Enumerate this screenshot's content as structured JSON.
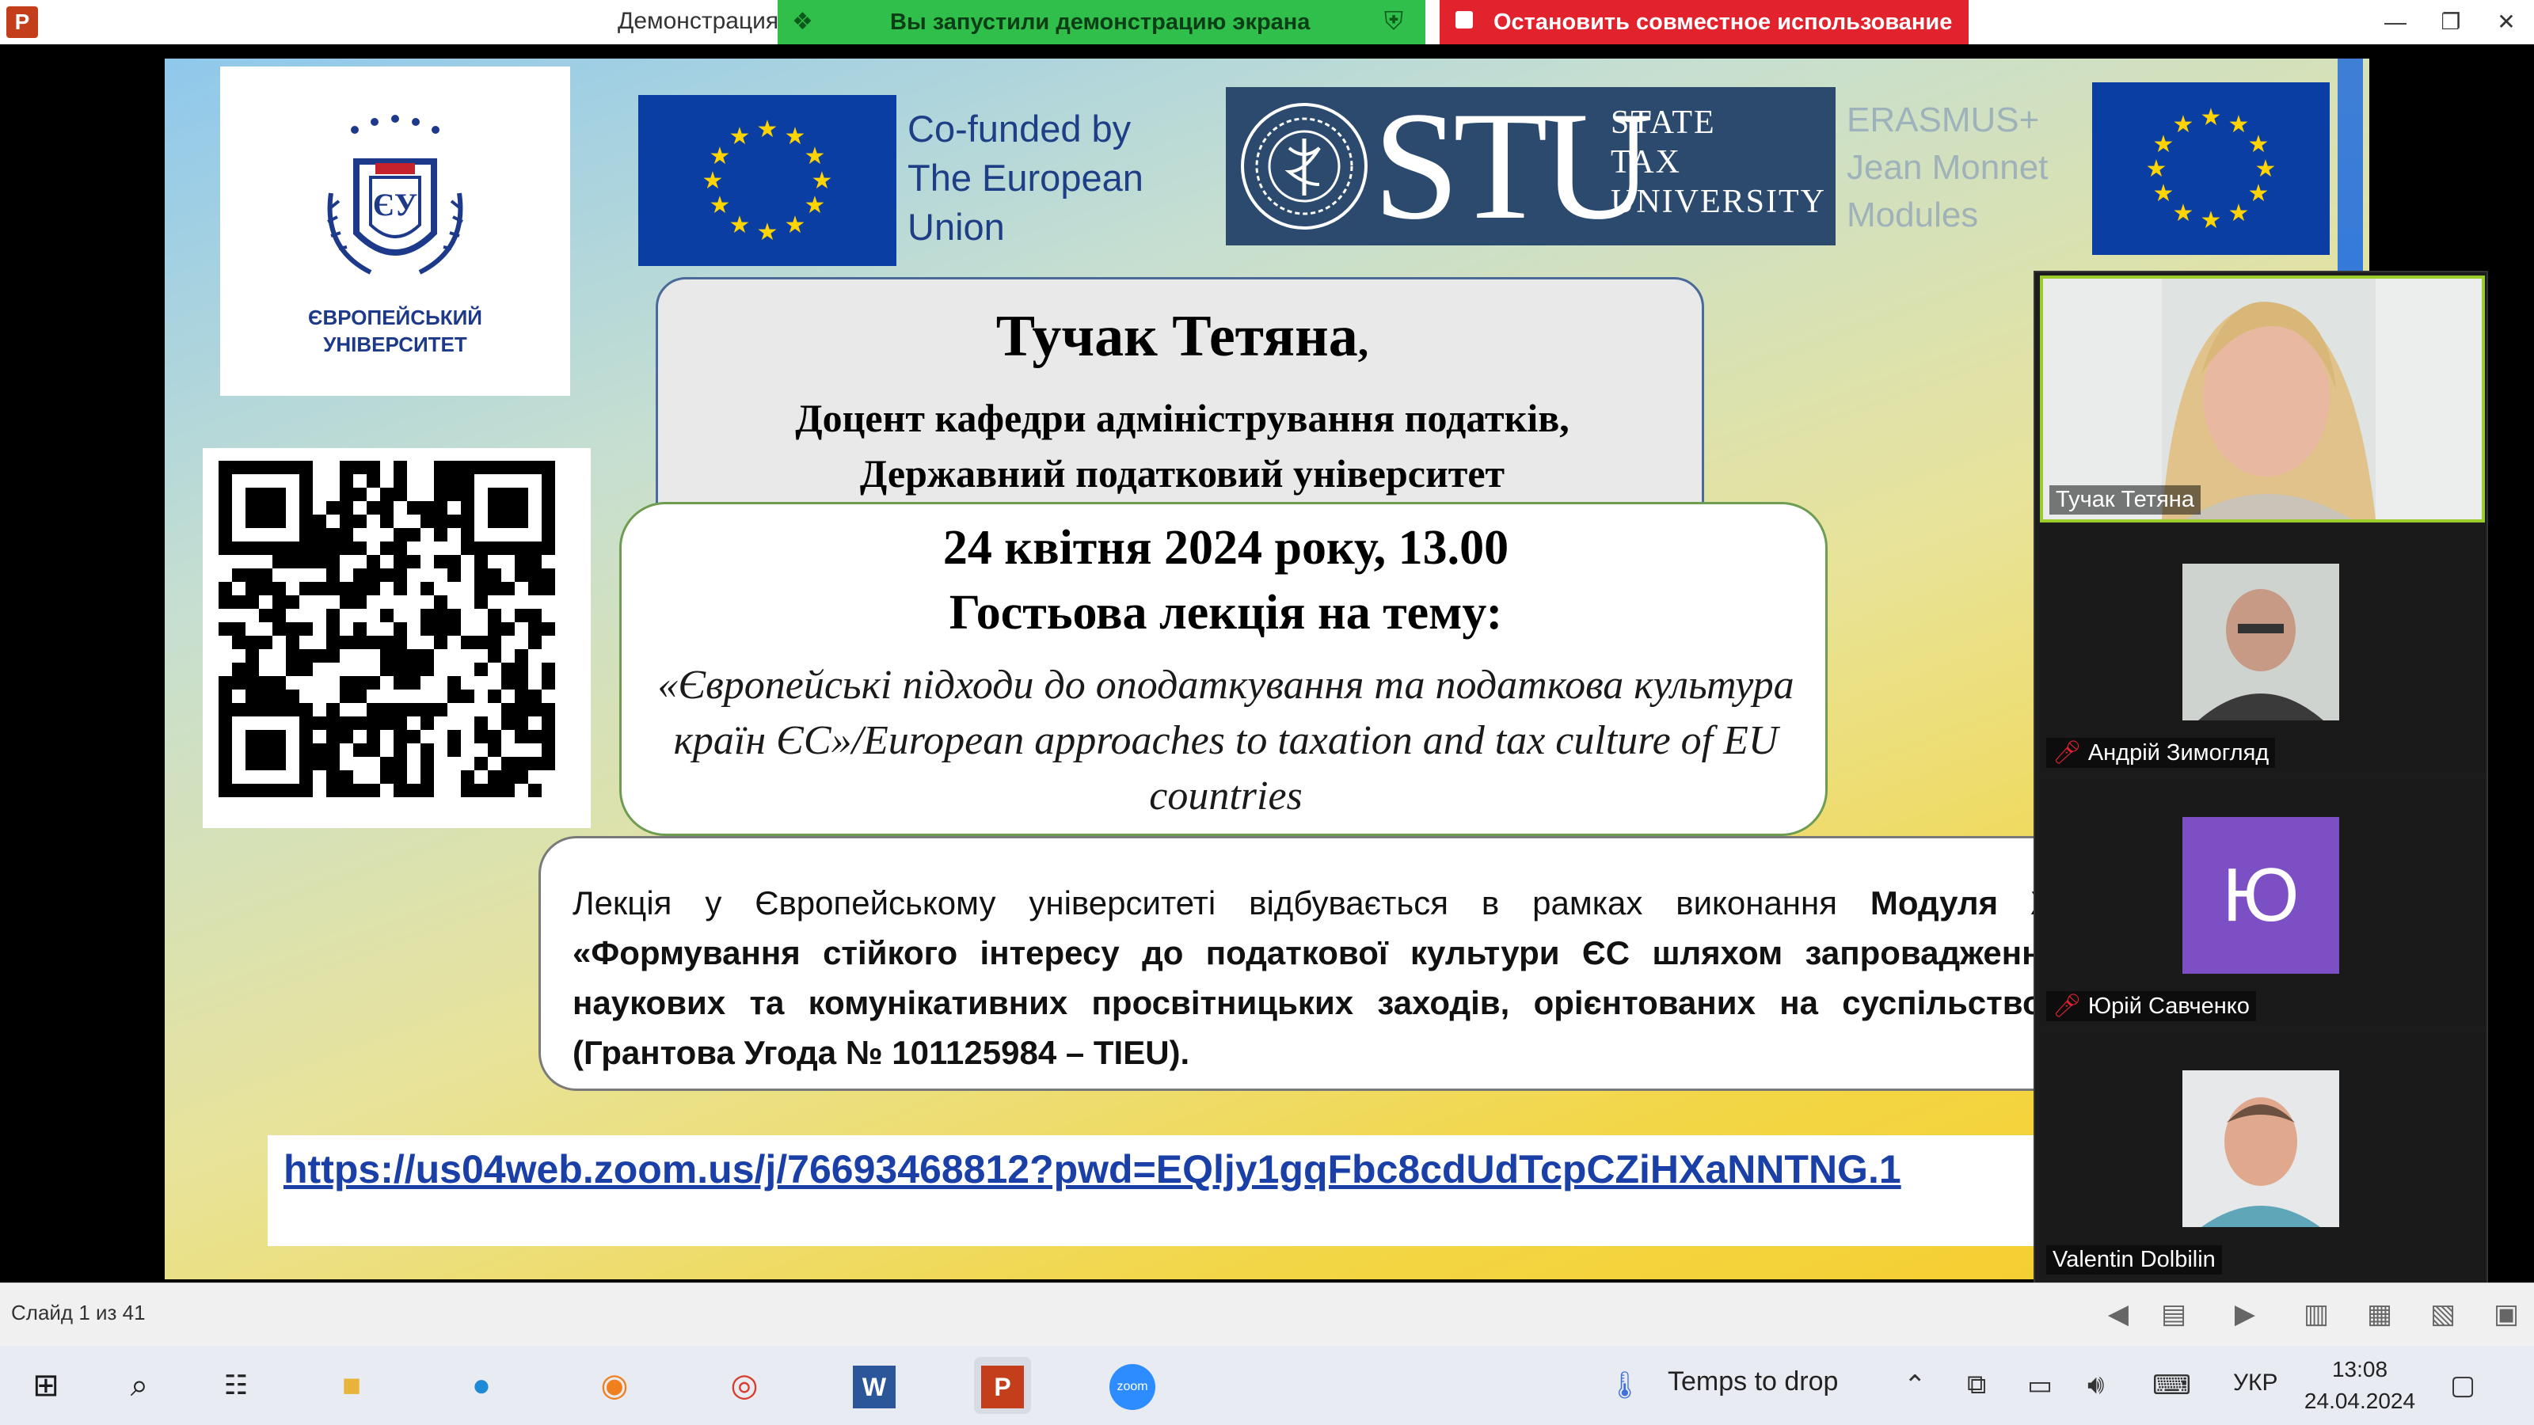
{
  "window": {
    "doc_title": "Демонстрация",
    "share_status": "Вы запустили демонстрацию экрана",
    "stop_share": "Остановить совместное использование",
    "app_icon": "P"
  },
  "slide": {
    "eu_logo_text": "ЄВРОПЕЙСЬКИЙ\nУНІВЕРСИТЕТ",
    "cofunded": "Co-funded by\nThe European\nUnion",
    "stu_letters": "STU",
    "stu_words": "STATE\nTAX\nUNIVERSITY",
    "erasmus": "ERASMUS+\nJean Monnet\nModules",
    "speaker_name": "Тучак Тетяна",
    "speaker_name_suffix": ",",
    "speaker_position": "Доцент кафедри адміністрування податків,\nДержавний податковий університет",
    "lecture_date": "24 квітня 2024 року, 13.00",
    "lecture_label": "Гостьова лекція на тему:",
    "lecture_topic": "«Європейські підходи до оподаткування та податкова культура країн ЄС»/European approaches to taxation and tax culture of EU countries",
    "module_text_start": "Лекція у Європейському університеті відбувається в рамках виконання ",
    "module_bold_1": "Модуля Ж",
    "module_bold_2": "«Формування стійкого інтересу до податкової культури ЄС шляхом запровадження наукових та комунікативних просвітницьких заходів, орієнтованих на суспільство»",
    "module_text_end": " (Грантова Угода №  101125984 – TIEU).",
    "zoom_link": "https://us04web.zoom.us/j/76693468812?pwd=EQljy1gqFbc8cdUdTcpCZiHXaNNTNG.1"
  },
  "participants": [
    {
      "name": "Тучак Тетяна",
      "muted": false,
      "active": true
    },
    {
      "name": "Андрій Зимогляд",
      "muted": true,
      "active": false
    },
    {
      "name": "Юрій Савченко",
      "muted": true,
      "active": false,
      "initial": "Ю",
      "color": "#7c4fc4"
    },
    {
      "name": "Valentin Dolbilin",
      "muted": false,
      "active": false
    }
  ],
  "statusbar": {
    "slide_counter": "Слайд 1 из 41"
  },
  "taskbar": {
    "weather": "Temps to drop",
    "lang": "УКР",
    "time": "13:08",
    "date": "24.04.2024"
  },
  "colors": {
    "share_green": "#2fbf4a",
    "share_red": "#e2232e",
    "eu_blue": "#0a3ea3",
    "stu_navy": "#2b4a6e",
    "link_blue": "#1a40a8",
    "active_speaker": "#9ccc2c"
  }
}
